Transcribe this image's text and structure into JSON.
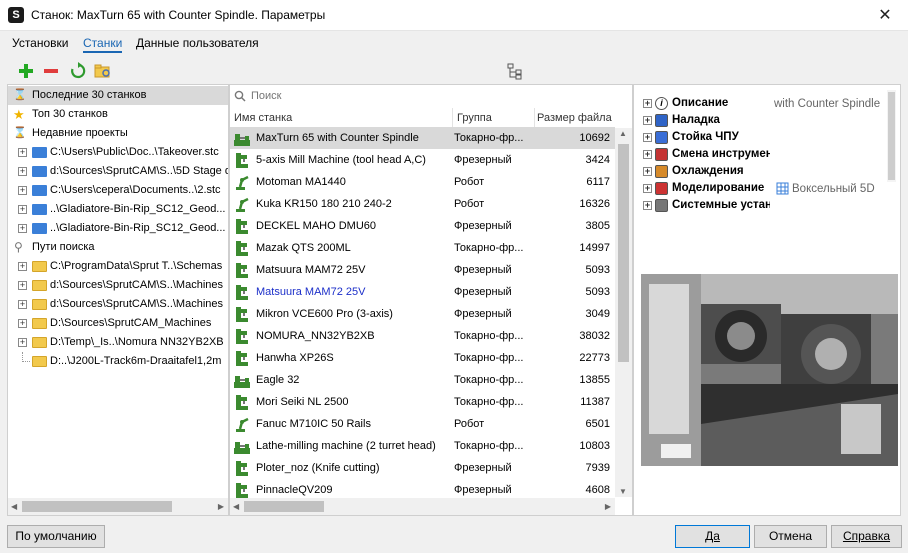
{
  "window": {
    "title": "Станок: MaxTurn 65 with Counter Spindle. Параметры",
    "close_glyph": "✕"
  },
  "tabs": [
    {
      "label": "Установки",
      "active": false
    },
    {
      "label": "Станки",
      "active": true
    },
    {
      "label": "Данные пользователя",
      "active": false
    }
  ],
  "toolbar": {
    "icons": [
      "add-icon",
      "remove-icon",
      "refresh-icon",
      "folder-browse-icon",
      "tree-view-icon"
    ]
  },
  "left_tree": {
    "items": [
      {
        "label": "Последние 30 станков",
        "icon": "hourglass-icon",
        "type": "root",
        "selected": true
      },
      {
        "label": "Топ 30 станков",
        "icon": "star-icon",
        "type": "root"
      },
      {
        "label": "Недавние проекты",
        "icon": "hourglass-icon",
        "type": "root"
      },
      {
        "label": "C:\\Users\\Public\\Doc..\\Takeover.stc",
        "type": "folder",
        "color": "blue"
      },
      {
        "label": "d:\\Sources\\SprutCAM\\S..\\5D Stage drilling.stc",
        "type": "folder",
        "color": "blue"
      },
      {
        "label": "C:\\Users\\cepera\\Documents..\\2.stc",
        "type": "folder",
        "color": "blue"
      },
      {
        "label": "..\\Gladiatore-Bin-Rip_SC12_Geod...",
        "type": "folder",
        "color": "blue"
      },
      {
        "label": "..\\Gladiatore-Bin-Rip_SC12_Geod...",
        "type": "folder",
        "color": "blue"
      },
      {
        "label": "Пути поиска",
        "icon": "search-paths-icon",
        "type": "root"
      },
      {
        "label": "C:\\ProgramData\\Sprut T..\\Schemas",
        "type": "folder",
        "color": "yellow"
      },
      {
        "label": "d:\\Sources\\SprutCAM\\S..\\Machines",
        "type": "folder",
        "color": "yellow"
      },
      {
        "label": "d:\\Sources\\SprutCAM\\S..\\Machines",
        "type": "folder",
        "color": "yellow"
      },
      {
        "label": "D:\\Sources\\SprutCAM_Machines",
        "type": "folder",
        "color": "yellow"
      },
      {
        "label": "D:\\Temp\\_Is..\\Nomura NN32YB2XB",
        "type": "folder",
        "color": "yellow"
      },
      {
        "label": "D:..\\J200L-Track6m-Draaitafel1,2m",
        "type": "folder",
        "color": "yellow",
        "noexpander": true
      }
    ]
  },
  "machines": {
    "search_placeholder": "Поиск",
    "columns": {
      "name": "Имя станка",
      "group": "Группа",
      "size": "Размер файла"
    },
    "rows": [
      {
        "name": "MaxTurn 65 with Counter Spindle",
        "group": "Токарно-фр...",
        "size": "10692",
        "icon": "lathe-icon",
        "selected": true
      },
      {
        "name": "5-axis Mill Machine (tool head A,C)",
        "group": "Фрезерный",
        "size": "3424",
        "icon": "mill-icon"
      },
      {
        "name": "Motoman MA1440",
        "group": "Робот",
        "size": "6117",
        "icon": "robot-icon"
      },
      {
        "name": "Kuka KR150 180 210 240-2",
        "group": "Робот",
        "size": "16326",
        "icon": "robot-icon"
      },
      {
        "name": "DECKEL MAHO DMU60",
        "group": "Фрезерный",
        "size": "3805",
        "icon": "mill-icon"
      },
      {
        "name": "Mazak QTS 200ML",
        "group": "Токарно-фр...",
        "size": "14997",
        "icon": "mill-icon"
      },
      {
        "name": "Matsuura MAM72 25V",
        "group": "Фрезерный",
        "size": "5093",
        "icon": "mill-icon"
      },
      {
        "name": "Matsuura MAM72 25V",
        "group": "Фрезерный",
        "size": "5093",
        "icon": "mill-icon",
        "highlight": true
      },
      {
        "name": "Mikron VCE600 Pro (3-axis)",
        "group": "Фрезерный",
        "size": "3049",
        "icon": "mill-icon"
      },
      {
        "name": "NOMURA_NN32YB2XB",
        "group": "Токарно-фр...",
        "size": "38032",
        "icon": "mill-icon"
      },
      {
        "name": "Hanwha XP26S",
        "group": "Токарно-фр...",
        "size": "22773",
        "icon": "mill-icon"
      },
      {
        "name": "Eagle 32",
        "group": "Токарно-фр...",
        "size": "13855",
        "icon": "lathe-icon"
      },
      {
        "name": "Mori Seiki NL 2500",
        "group": "Токарно-фр...",
        "size": "11387",
        "icon": "mill-icon"
      },
      {
        "name": "Fanuc M710IC 50 Rails",
        "group": "Робот",
        "size": "6501",
        "icon": "robot-icon"
      },
      {
        "name": "Lathe-milling machine (2 turret head)",
        "group": "Токарно-фр...",
        "size": "10803",
        "icon": "lathe-icon"
      },
      {
        "name": "Ploter_noz (Knife cutting)",
        "group": "Фрезерный",
        "size": "7939",
        "icon": "mill-icon"
      },
      {
        "name": "PinnacleQV209",
        "group": "Фрезерный",
        "size": "4608",
        "icon": "mill-icon"
      }
    ]
  },
  "properties": {
    "items": [
      {
        "label": "Описание",
        "icon": "info-icon",
        "value": "with Counter Spindle"
      },
      {
        "label": "Наладка",
        "icon": "setup-icon"
      },
      {
        "label": "Стойка ЧПУ",
        "icon": "cnc-icon"
      },
      {
        "label": "Смена инструмента",
        "icon": "tool-change-icon"
      },
      {
        "label": "Охлаждения",
        "icon": "coolant-icon"
      },
      {
        "label": "Моделирование",
        "icon": "simulation-icon",
        "value": "Воксельный 5D"
      },
      {
        "label": "Системные установки",
        "icon": "system-settings-icon"
      }
    ],
    "photo": "machine-photo"
  },
  "buttons": {
    "defaults": "По умолчанию",
    "ok": "Да",
    "cancel": "Отмена",
    "help": "Справка"
  },
  "colors": {
    "accent": "#1a66b3",
    "selection": "#d9d9d9",
    "highlight_text": "#1c2fc9",
    "machine_icon": "#3b8a2f"
  }
}
